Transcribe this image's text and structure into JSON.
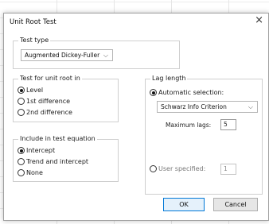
{
  "window": {
    "title": "Unit Root Test",
    "close_glyph": "×"
  },
  "test_type": {
    "label": "Test type",
    "selected": "Augmented Dickey-Fuller"
  },
  "unit_root_in": {
    "label": "Test for unit root in",
    "options": [
      {
        "label": "Level",
        "selected": true
      },
      {
        "label": "1st difference",
        "selected": false
      },
      {
        "label": "2nd difference",
        "selected": false
      }
    ]
  },
  "include": {
    "label": "Include in test equation",
    "options": [
      {
        "label": "Intercept",
        "selected": true
      },
      {
        "label": "Trend and intercept",
        "selected": false
      },
      {
        "label": "None",
        "selected": false
      }
    ]
  },
  "lag_length": {
    "label": "Lag length",
    "auto": {
      "label": "Automatic selection:",
      "selected": true
    },
    "criterion": "Schwarz Info Criterion",
    "max_lags_label": "Maximum lags:",
    "max_lags": "5",
    "user": {
      "label": "User specified:",
      "selected": false
    },
    "user_value": "1"
  },
  "buttons": {
    "ok": "OK",
    "cancel": "Cancel"
  },
  "icons": {
    "dropdown": "chevron-down-icon",
    "close": "close-icon"
  }
}
